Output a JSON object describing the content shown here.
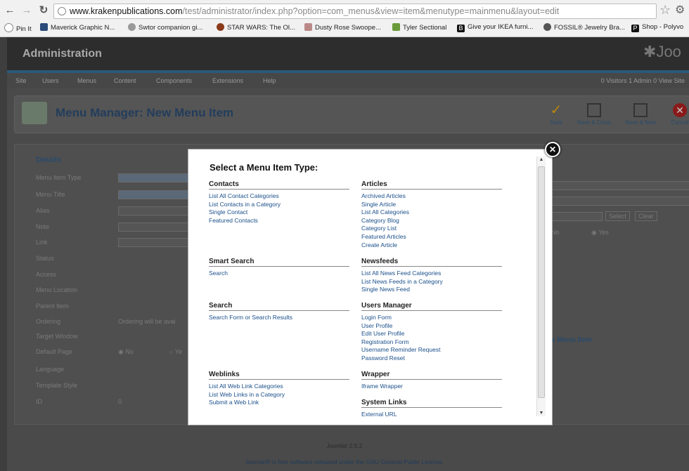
{
  "browser": {
    "url_host": "www.krakenpublications.com",
    "url_path": "/test/administrator/index.php?option=com_menus&view=item&menutype=mainmenu&layout=edit",
    "bookmarks": [
      "Pin It",
      "Maverick Graphic N...",
      "Swtor companion gi...",
      "STAR WARS: The Ol...",
      "Dusty Rose Swoope...",
      "Tyler Sectional",
      "Give your IKEA furni...",
      "FOSSIL® Jewelry Bra...",
      "Shop - Polyvo"
    ]
  },
  "admin": {
    "title": "Administration",
    "logo": "Joo",
    "menu": [
      "Site",
      "Users",
      "Menus",
      "Content",
      "Components",
      "Extensions",
      "Help"
    ],
    "status": "0 Visitors   1 Admin   0   View Site",
    "page_title": "Menu Manager: New Menu Item",
    "toolbar": [
      "Save",
      "Save & Close",
      "Save & New",
      "Cancel"
    ],
    "details_label": "Details",
    "fields": [
      "Menu Item Type",
      "Menu Title",
      "Alias",
      "Note",
      "Link",
      "Status",
      "Access",
      "Menu Location",
      "Parent Item",
      "Ordering",
      "Target Window",
      "Default Page",
      "Language",
      "Template Style",
      "ID"
    ],
    "ordering_text": "Ordering will be avai",
    "default_no": "No",
    "default_yes": "Ye",
    "id_value": "0",
    "right_select": "Select",
    "right_clear": "Clear",
    "right_no": "No",
    "right_yes": "Yes",
    "right_menu_item": "s Menu Item",
    "footer_version": "Joomla! 2.5.2",
    "footer_text": "Joomla!® is free software released under the GNU General Public License."
  },
  "modal": {
    "title": "Select a Menu Item Type:",
    "groups": {
      "contacts": {
        "title": "Contacts",
        "items": [
          "List All Contact Categories",
          "List Contacts in a Category",
          "Single Contact",
          "Featured Contacts"
        ]
      },
      "articles": {
        "title": "Articles",
        "items": [
          "Archived Articles",
          "Single Article",
          "List All Categories",
          "Category Blog",
          "Category List",
          "Featured Articles",
          "Create Article"
        ]
      },
      "smart_search": {
        "title": "Smart Search",
        "items": [
          "Search"
        ]
      },
      "newsfeeds": {
        "title": "Newsfeeds",
        "items": [
          "List All News Feed Categories",
          "List News Feeds in a Category",
          "Single News Feed"
        ]
      },
      "search": {
        "title": "Search",
        "items": [
          "Search Form or Search Results"
        ]
      },
      "users_manager": {
        "title": "Users Manager",
        "items": [
          "Login Form",
          "User Profile",
          "Edit User Profile",
          "Registration Form",
          "Username Reminder Request",
          "Password Reset"
        ]
      },
      "weblinks": {
        "title": "Weblinks",
        "items": [
          "List All Web Link Categories",
          "List Web Links in a Category",
          "Submit a Web Link"
        ]
      },
      "wrapper": {
        "title": "Wrapper",
        "items": [
          "Iframe Wrapper"
        ]
      },
      "system_links": {
        "title": "System Links",
        "items": [
          "External URL"
        ]
      }
    }
  }
}
